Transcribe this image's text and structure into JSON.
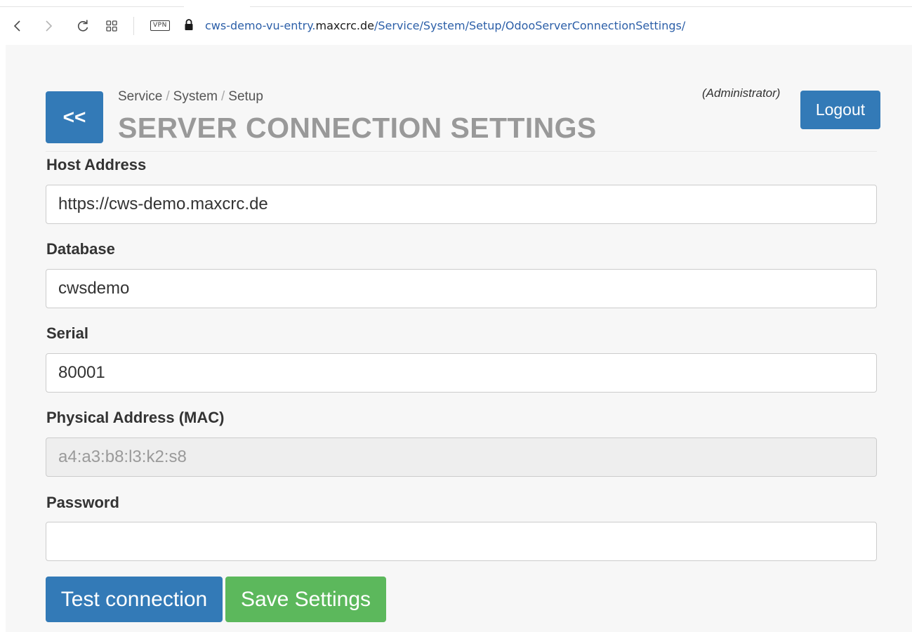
{
  "browser": {
    "vpn_label": "VPN",
    "url_prefix": "cws-demo-vu-entry.",
    "url_host": "maxcrc.de",
    "url_path": "/Service/System/Setup/OdooServerConnectionSettings/"
  },
  "header": {
    "back_label": "<<",
    "breadcrumb": [
      "Service",
      "System",
      "Setup"
    ],
    "breadcrumb_separator": "/",
    "title": "SERVER CONNECTION SETTINGS",
    "user_role": "(Administrator)",
    "logout_label": "Logout"
  },
  "form": {
    "host_address": {
      "label": "Host Address",
      "value": "https://cws-demo.maxcrc.de"
    },
    "database": {
      "label": "Database",
      "value": "cwsdemo"
    },
    "serial": {
      "label": "Serial",
      "value": "80001"
    },
    "mac": {
      "label": "Physical Address (MAC)",
      "value": "a4:a3:b8:l3:k2:s8"
    },
    "password": {
      "label": "Password",
      "value": ""
    }
  },
  "actions": {
    "test_label": "Test connection",
    "save_label": "Save Settings"
  },
  "colors": {
    "primary": "#337ab7",
    "success": "#5cb85c",
    "title_gray": "#999999"
  }
}
